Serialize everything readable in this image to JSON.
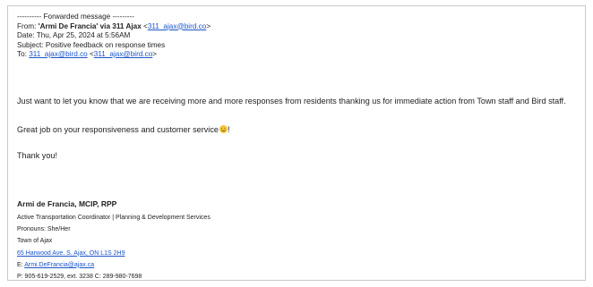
{
  "forwarded": {
    "banner": "---------- Forwarded message ---------",
    "from_label": "From: ",
    "from_name": "'Armi De Francia' via 311 Ajax",
    "from_email": "311_ajax@bird.co",
    "date_line": "Date: Thu, Apr 25, 2024 at 5:56AM",
    "subject_line": "Subject: Positive feedback on response times",
    "to_label": "To: ",
    "to_email_1": "311_ajax@bird.co",
    "to_email_2": "311_ajax@bird.co"
  },
  "body": {
    "paragraph_1": "Just want to let you know that we are receiving more and more responses from residents thanking us for immediate action from Town staff and Bird staff.",
    "paragraph_2_before": "Great job on your responsiveness and customer service",
    "paragraph_2_after": "!",
    "paragraph_3": "Thank you!"
  },
  "signature": {
    "name": "Armi de Francia, MCIP, RPP",
    "title": "Active Transportation Coordinator | Planning & Development Services",
    "pronouns": "Pronouns: She/Her",
    "org": "Town of Ajax",
    "address": "65 Harwood Ave. S. Ajax, ON L1S 2H9",
    "email_label": "E: ",
    "email": "Armi.DeFrancia@ajax.ca",
    "phone": "P: 905-619-2529, ext. 3238 C: 289-980-7698"
  },
  "icons": {
    "emoji": "smiling-face-emoji-icon"
  },
  "colors": {
    "link": "#1a55c9",
    "text": "#222222",
    "border": "#c9c9c9"
  }
}
